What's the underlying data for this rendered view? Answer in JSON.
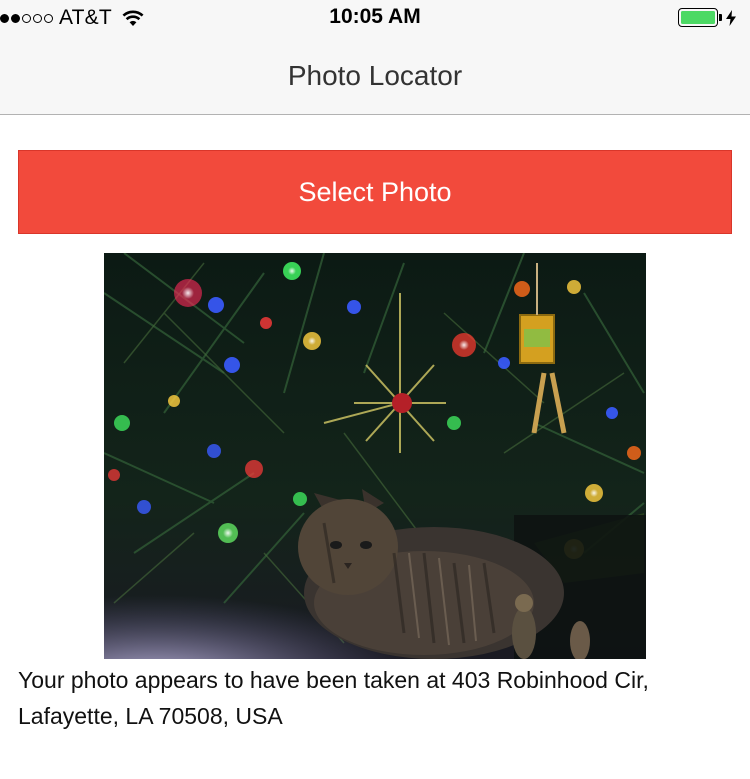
{
  "status_bar": {
    "carrier": "AT&T",
    "time": "10:05 AM",
    "signal_bars_filled": 2,
    "signal_bars_total": 5,
    "battery_level": 1.0,
    "battery_color": "#4cd964",
    "charging": true,
    "icons": [
      "signal-dots-icon",
      "wifi-icon",
      "battery-icon",
      "charging-bolt-icon"
    ]
  },
  "nav": {
    "title": "Photo Locator"
  },
  "select_button": {
    "label": "Select Photo",
    "color": "#f24a3c"
  },
  "photo": {
    "subject": "selected-photo"
  },
  "result": {
    "text": "Your photo appears to have been taken at 403 Robinhood Cir, Lafayette, LA 70508, USA"
  }
}
